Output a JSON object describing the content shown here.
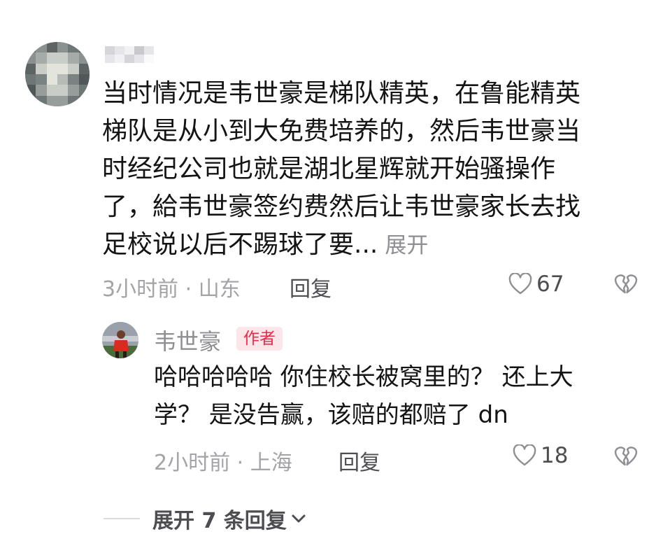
{
  "comment": {
    "author": "",
    "text": "当时情况是韦世豪是梯队精英，在鲁能精英\n梯队是从小到大免费培养的，然后韦世豪当\n时经纪公司也就是湖北星辉就开始骚操作\n了，給韦世豪签约费然后让韦世豪家长去找\n足校说以后不踢球了要...",
    "expand_label": "展开",
    "time": "3小时前",
    "location": "山东",
    "reply_label": "回复",
    "likes": "67"
  },
  "reply": {
    "author": "韦世豪",
    "badge": "作者",
    "text": "哈哈哈哈哈 你住校长被窝里的？ 还上大\n学？ 是没告赢，该赔的都赔了 dn",
    "time": "2小时前",
    "location": "上海",
    "reply_label": "回复",
    "likes": "18"
  },
  "expand_replies": {
    "label": "展开 7 条回复"
  },
  "icons": {
    "like": "heart-outline-icon",
    "dislike": "broken-heart-icon",
    "chevron": "chevron-down-icon"
  },
  "colors": {
    "badge_text": "#f0284a",
    "badge_bg": "#fde6ea",
    "meta_text": "#a3a3a8",
    "body_text": "#141414"
  }
}
